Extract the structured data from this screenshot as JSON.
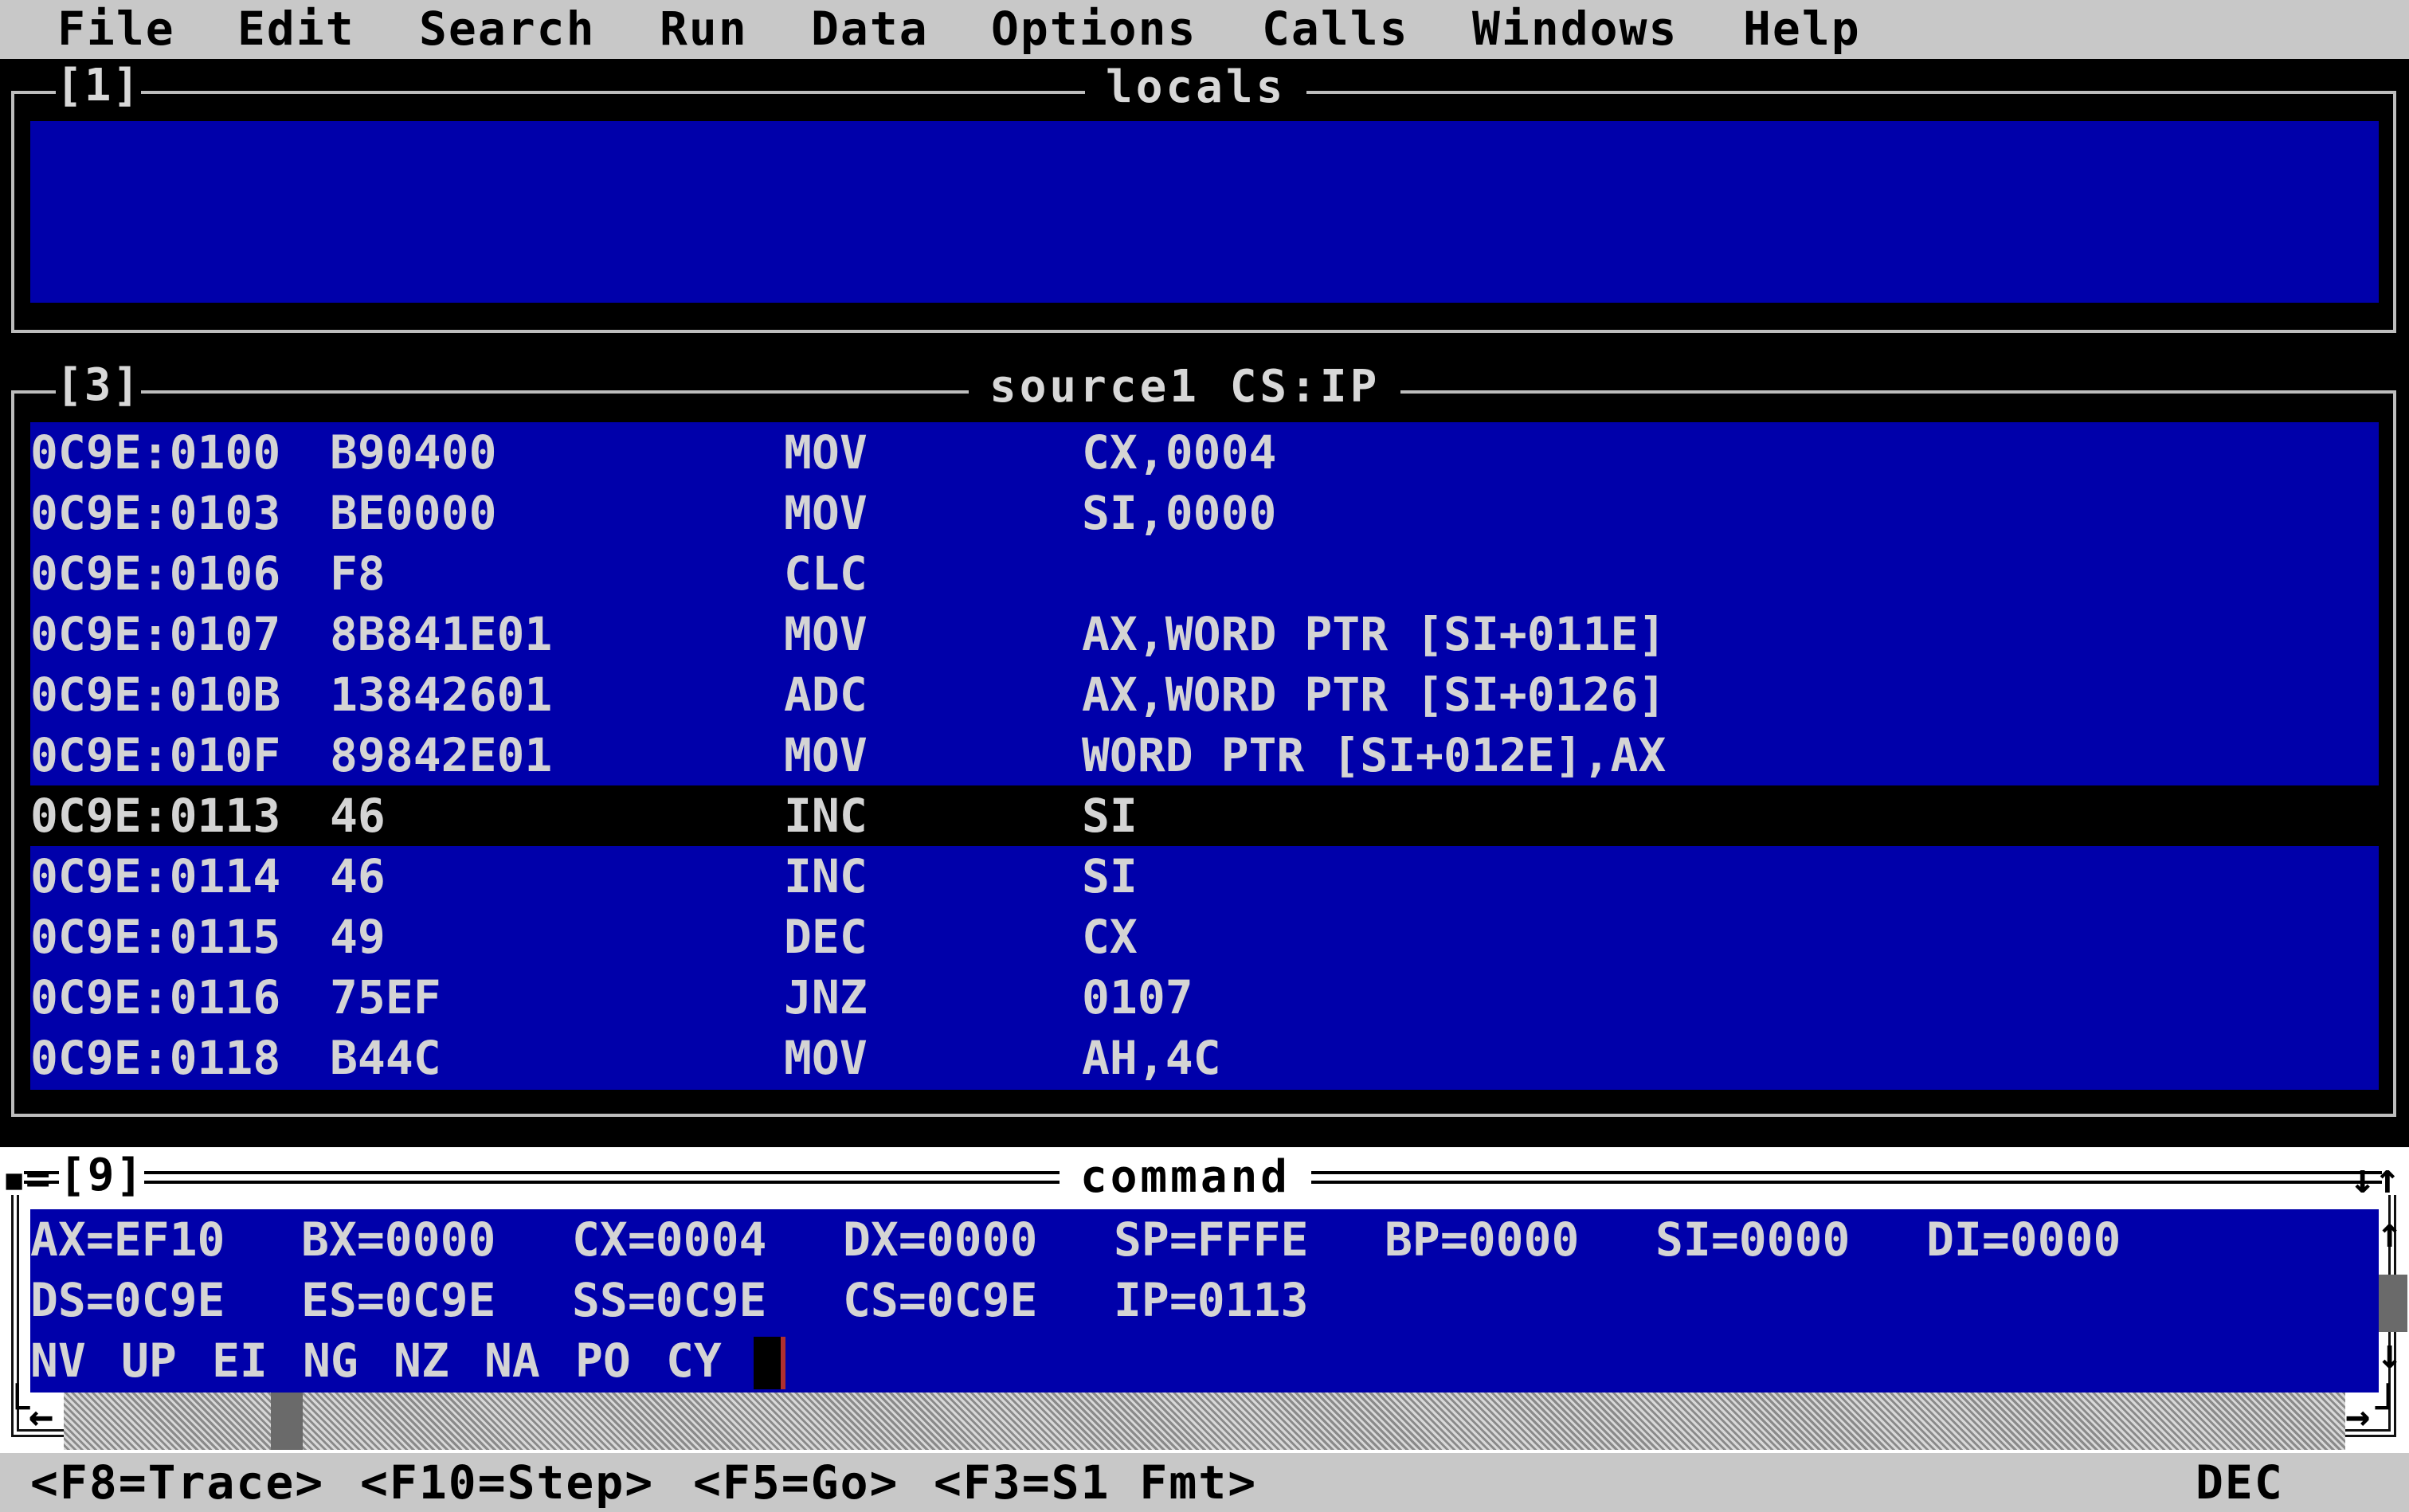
{
  "menu": {
    "items": [
      "File",
      "Edit",
      "Search",
      "Run",
      "Data",
      "Options",
      "Calls",
      "Windows",
      "Help"
    ]
  },
  "locals_window": {
    "number": "[1]",
    "title": "locals"
  },
  "source_window": {
    "number": "[3]",
    "title": "source1 CS:IP",
    "rows": [
      {
        "addr": "0C9E:0100",
        "bytes": "B90400",
        "mnemonic": "MOV",
        "operands": "CX,0004",
        "current": false
      },
      {
        "addr": "0C9E:0103",
        "bytes": "BE0000",
        "mnemonic": "MOV",
        "operands": "SI,0000",
        "current": false
      },
      {
        "addr": "0C9E:0106",
        "bytes": "F8",
        "mnemonic": "CLC",
        "operands": "",
        "current": false
      },
      {
        "addr": "0C9E:0107",
        "bytes": "8B841E01",
        "mnemonic": "MOV",
        "operands": "AX,WORD PTR [SI+011E]",
        "current": false
      },
      {
        "addr": "0C9E:010B",
        "bytes": "13842601",
        "mnemonic": "ADC",
        "operands": "AX,WORD PTR [SI+0126]",
        "current": false
      },
      {
        "addr": "0C9E:010F",
        "bytes": "89842E01",
        "mnemonic": "MOV",
        "operands": "WORD PTR [SI+012E],AX",
        "current": false
      },
      {
        "addr": "0C9E:0113",
        "bytes": "46",
        "mnemonic": "INC",
        "operands": "SI",
        "current": true
      },
      {
        "addr": "0C9E:0114",
        "bytes": "46",
        "mnemonic": "INC",
        "operands": "SI",
        "current": false
      },
      {
        "addr": "0C9E:0115",
        "bytes": "49",
        "mnemonic": "DEC",
        "operands": "CX",
        "current": false
      },
      {
        "addr": "0C9E:0116",
        "bytes": "75EF",
        "mnemonic": "JNZ",
        "operands": "0107",
        "current": false
      },
      {
        "addr": "0C9E:0118",
        "bytes": "B44C",
        "mnemonic": "MOV",
        "operands": "AH,4C",
        "current": false
      }
    ]
  },
  "command_window": {
    "number": "[9]",
    "title": "command",
    "registers_line1": [
      "AX=EF10",
      "BX=0000",
      "CX=0004",
      "DX=0000",
      "SP=FFFE",
      "BP=0000",
      "SI=0000",
      "DI=0000"
    ],
    "registers_line2": [
      "DS=0C9E",
      "ES=0C9E",
      "SS=0C9E",
      "CS=0C9E",
      "IP=0113"
    ],
    "flags": [
      "NV",
      "UP",
      "EI",
      "NG",
      "NZ",
      "NA",
      "PO",
      "CY"
    ]
  },
  "status": {
    "hints": [
      "<F8=Trace>",
      "<F10=Step>",
      "<F5=Go>",
      "<F3=S1 Fmt>"
    ],
    "mode": "DEC"
  },
  "colors": {
    "pane_blue": "#0000aa",
    "menu_gray": "#c8c8c8",
    "text": "#d4d4d4"
  }
}
